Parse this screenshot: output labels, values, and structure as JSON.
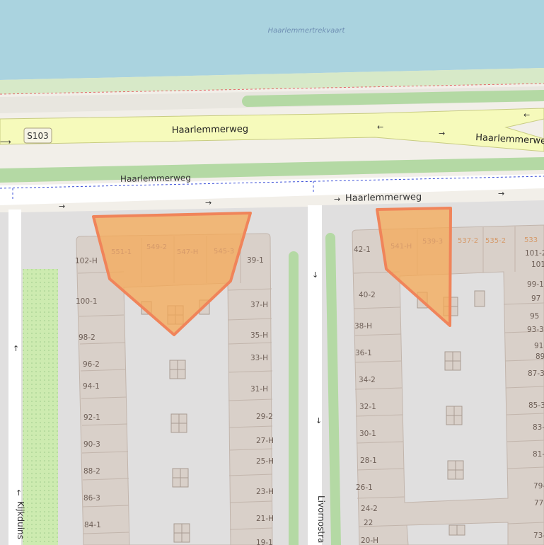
{
  "map": {
    "water_label": "Haarlemmertrekvaart",
    "road_shield": "S103",
    "roads": {
      "main_west": "Haarlemmerweg",
      "main_east": "Haarlemmerwe",
      "service_lower": "Haarlemmerweg",
      "service_right": "Haarlemmerweg",
      "street_left": "Kijkduins",
      "street_mid": "Livornostra"
    },
    "housenumbers": {
      "left_top": [
        "551-1",
        "549-2",
        "547-H",
        "545-3"
      ],
      "left_col_a": [
        "102-H",
        "100-1",
        "98-2",
        "96-2",
        "94-1",
        "92-1",
        "90-3",
        "88-2",
        "86-3",
        "84-1"
      ],
      "left_col_b": [
        "39-1",
        "37-H",
        "35-H",
        "33-H",
        "31-H",
        "29-2",
        "27-H",
        "25-H",
        "23-H",
        "21-H",
        "19-1"
      ],
      "right_top": [
        "541-H",
        "539-3",
        "537-2",
        "535-2",
        "533"
      ],
      "right_col_a": [
        "42-1",
        "40-2",
        "38-H",
        "36-1",
        "34-2",
        "32-1",
        "30-1",
        "28-1",
        "26-1",
        "24-2",
        "22",
        "20-H"
      ],
      "right_col_b": [
        "101-2",
        "101",
        "99-1",
        "97",
        "95",
        "93-3",
        "91-",
        "89",
        "87-3",
        "85-3",
        "83-",
        "81-",
        "79-",
        "77-",
        "73-"
      ]
    },
    "colors": {
      "water": "#aad3df",
      "land": "#f2efe9",
      "park": "#c8e6bc",
      "building": "#d9d0c9",
      "trunk_road": "#f6fabb",
      "highlight_fill": "#f5a955",
      "highlight_stroke": "#f0845a",
      "boundary": "#3b4fd8"
    }
  }
}
